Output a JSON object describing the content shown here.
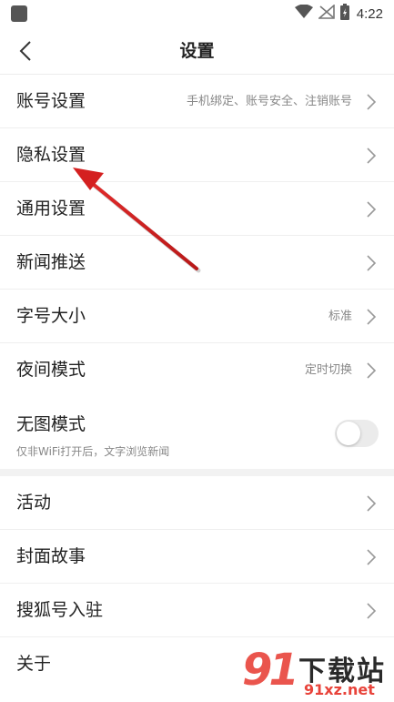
{
  "status_bar": {
    "time": "4:22"
  },
  "header": {
    "title": "设置"
  },
  "rows": [
    {
      "label": "账号设置",
      "value": "手机绑定、账号安全、注销账号"
    },
    {
      "label": "隐私设置",
      "value": ""
    },
    {
      "label": "通用设置",
      "value": ""
    },
    {
      "label": "新闻推送",
      "value": ""
    },
    {
      "label": "字号大小",
      "value": "标准"
    },
    {
      "label": "夜间模式",
      "value": "定时切换"
    }
  ],
  "no_image_mode": {
    "label": "无图模式",
    "description": "仅非WiFi打开后，文字浏览新闻",
    "enabled": false
  },
  "rows2": [
    {
      "label": "活动"
    },
    {
      "label": "封面故事"
    },
    {
      "label": "搜狐号入驻"
    },
    {
      "label": "关于"
    }
  ],
  "watermark": {
    "logo": "91",
    "title": "下载站",
    "url": "91xz.net"
  },
  "colors": {
    "accent_arrow": "#d42020",
    "watermark_red": "#e8433a"
  }
}
